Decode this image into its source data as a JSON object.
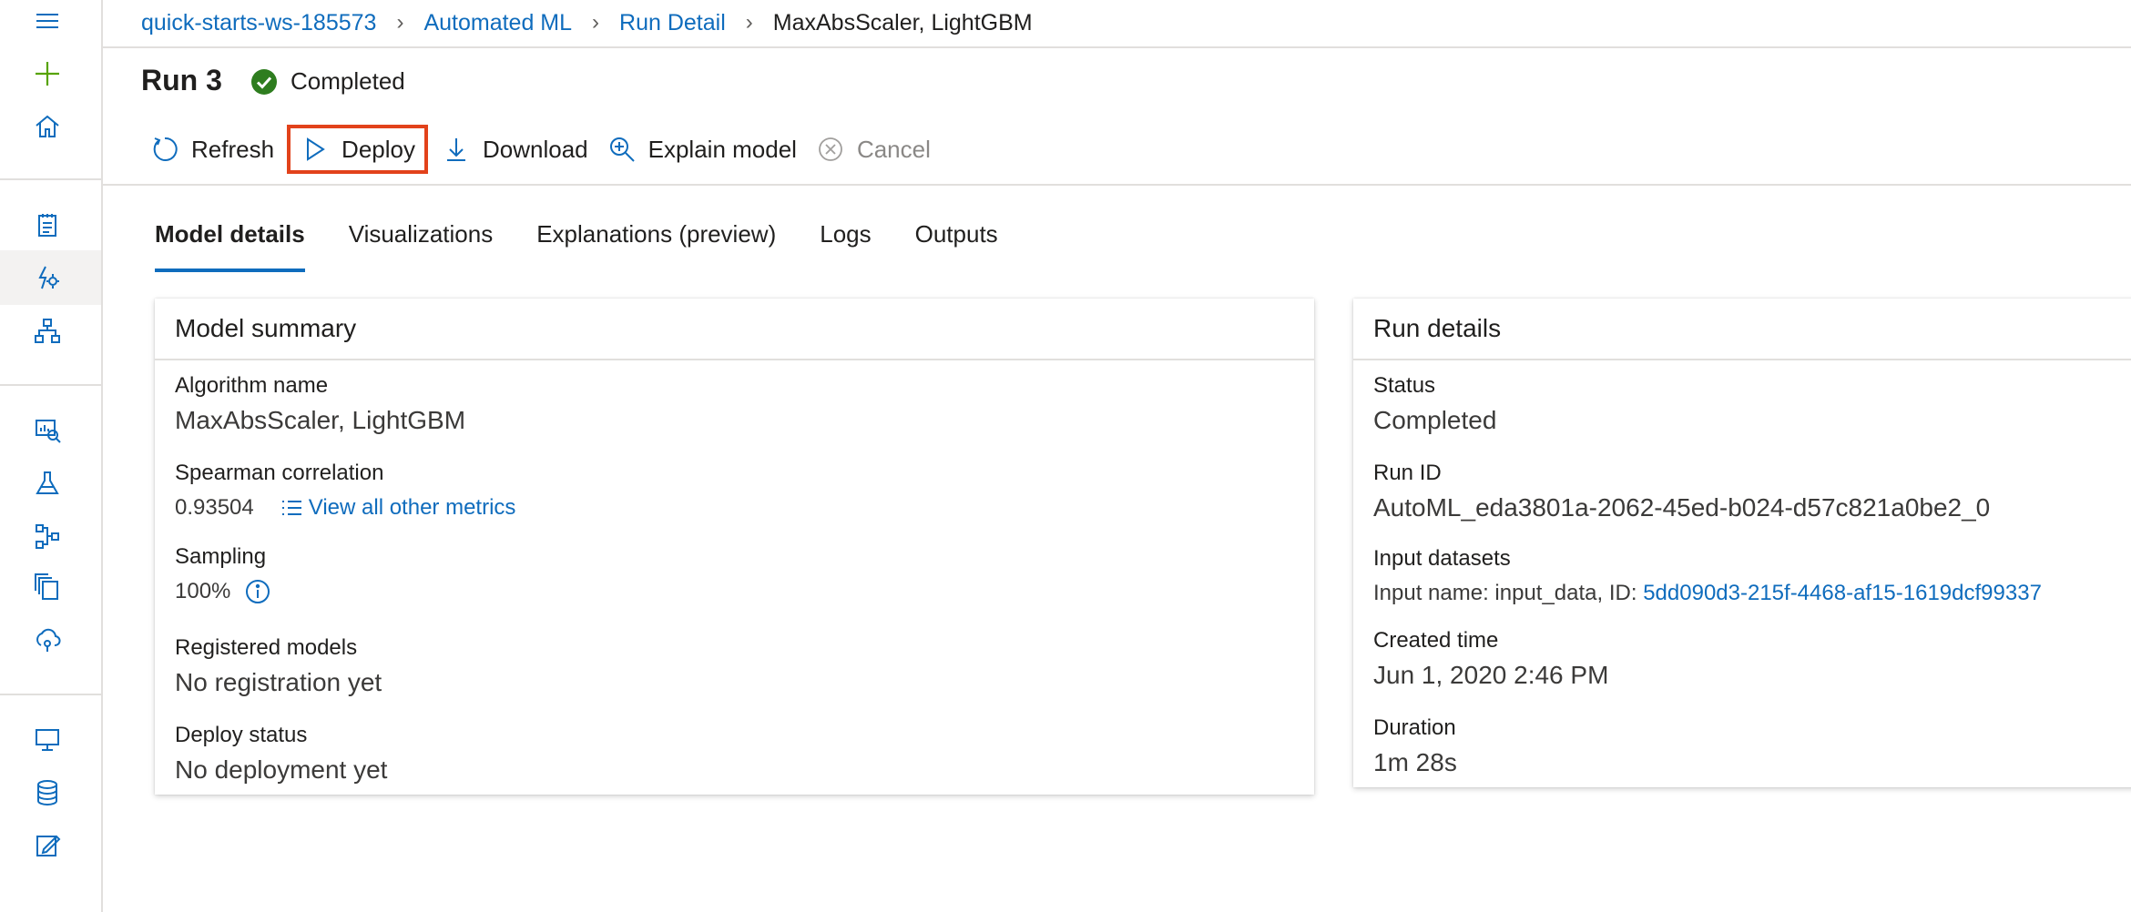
{
  "breadcrumb": {
    "items": [
      "quick-starts-ws-185573",
      "Automated ML",
      "Run Detail"
    ],
    "current": "MaxAbsScaler, LightGBM"
  },
  "run": {
    "title": "Run 3",
    "status": "Completed"
  },
  "toolbar": {
    "refresh": "Refresh",
    "deploy": "Deploy",
    "download": "Download",
    "explain": "Explain model",
    "cancel": "Cancel"
  },
  "tabs": [
    "Model details",
    "Visualizations",
    "Explanations (preview)",
    "Logs",
    "Outputs"
  ],
  "model_summary": {
    "heading": "Model summary",
    "algorithm_label": "Algorithm name",
    "algorithm_value": "MaxAbsScaler, LightGBM",
    "spearman_label": "Spearman correlation",
    "spearman_value": "0.93504",
    "metrics_link": "View all other metrics",
    "sampling_label": "Sampling",
    "sampling_value": "100%",
    "registered_label": "Registered models",
    "registered_value": "No registration yet",
    "deploy_label": "Deploy status",
    "deploy_value": "No deployment yet"
  },
  "run_details": {
    "heading": "Run details",
    "status_label": "Status",
    "status_value": "Completed",
    "runid_label": "Run ID",
    "runid_value": "AutoML_eda3801a-2062-45ed-b024-d57c821a0be2_0",
    "datasets_label": "Input datasets",
    "datasets_prefix": "Input name: input_data, ID: ",
    "datasets_id": "5dd090d3-215f-4468-af15-1619dcf99337",
    "created_label": "Created time",
    "created_value": "Jun 1, 2020 2:46 PM",
    "duration_label": "Duration",
    "duration_value": "1m 28s"
  },
  "colors": {
    "link": "#0f6cbd",
    "success": "#2e7d1f",
    "highlight": "#e2421b",
    "plus": "#57a300"
  }
}
